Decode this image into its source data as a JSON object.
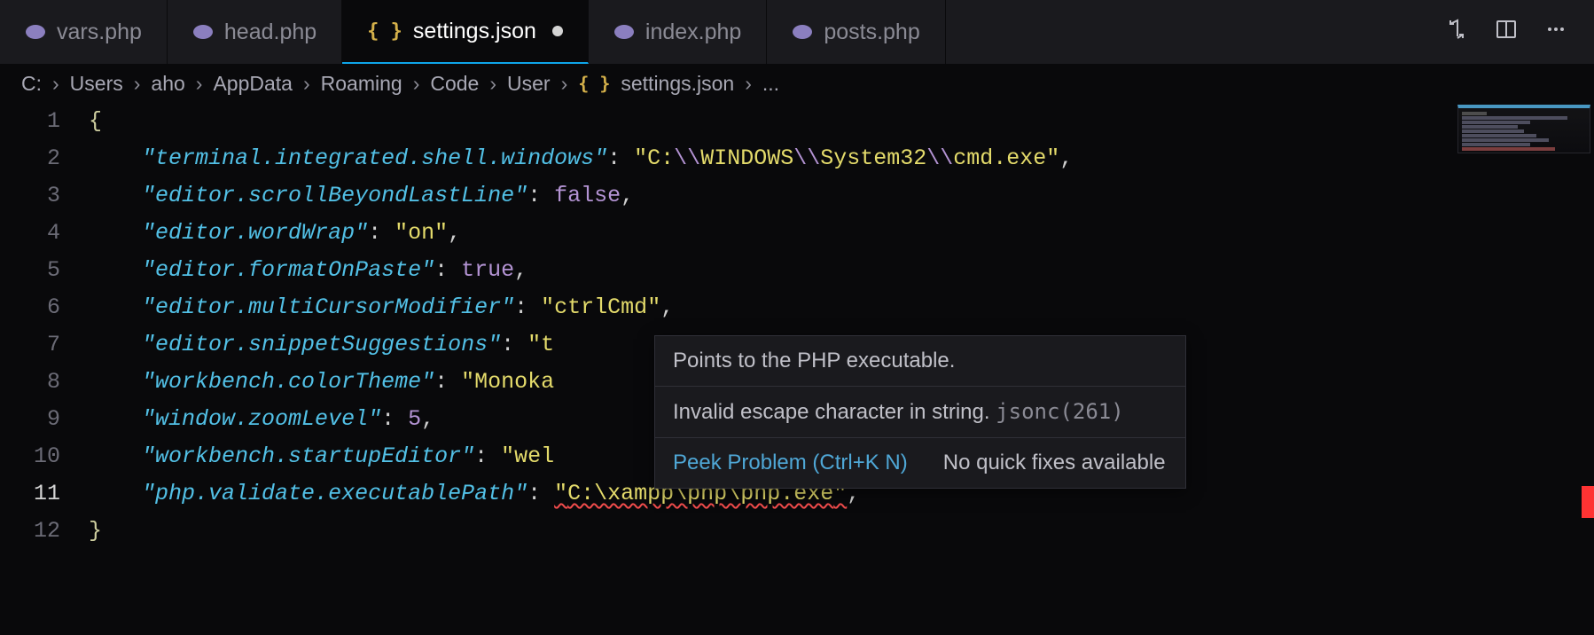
{
  "tabs": [
    {
      "label": "vars.php",
      "type": "php",
      "active": false
    },
    {
      "label": "head.php",
      "type": "php",
      "active": false
    },
    {
      "label": "settings.json",
      "type": "json",
      "active": true,
      "dirty": true
    },
    {
      "label": "index.php",
      "type": "php",
      "active": false
    },
    {
      "label": "posts.php",
      "type": "php",
      "active": false
    }
  ],
  "breadcrumb": [
    "C:",
    "Users",
    "aho",
    "AppData",
    "Roaming",
    "Code",
    "User",
    "settings.json",
    "..."
  ],
  "code_lines": {
    "l1": "{",
    "l2": {
      "key": "terminal.integrated.shell.windows",
      "val": "C:\\\\WINDOWS\\\\System32\\\\cmd.exe",
      "trail": ","
    },
    "l3": {
      "key": "editor.scrollBeyondLastLine",
      "bool": "false",
      "trail": ","
    },
    "l4": {
      "key": "editor.wordWrap",
      "val": "on",
      "trail": ","
    },
    "l5": {
      "key": "editor.formatOnPaste",
      "bool": "true",
      "trail": ","
    },
    "l6": {
      "key": "editor.multiCursorModifier",
      "val": "ctrlCmd",
      "trail": ","
    },
    "l7": {
      "key": "editor.snippetSuggestions",
      "val_partial": "t"
    },
    "l8": {
      "key": "workbench.colorTheme",
      "val_partial": "Monoka"
    },
    "l9": {
      "key": "window.zoomLevel",
      "num": "5",
      "trail": ","
    },
    "l10": {
      "key": "workbench.startupEditor",
      "val_partial": "wel"
    },
    "l11": {
      "key": "php.validate.executablePath",
      "err": "C:\\xampp\\php\\php.exe",
      "trail": ","
    },
    "l12": "}"
  },
  "line_numbers": [
    "1",
    "2",
    "3",
    "4",
    "5",
    "6",
    "7",
    "8",
    "9",
    "10",
    "11",
    "12"
  ],
  "hover": {
    "desc": "Points to the PHP executable.",
    "error": "Invalid escape character in string.",
    "error_code": "jsonc(261)",
    "peek": "Peek Problem (Ctrl+K N)",
    "nofix": "No quick fixes available"
  }
}
